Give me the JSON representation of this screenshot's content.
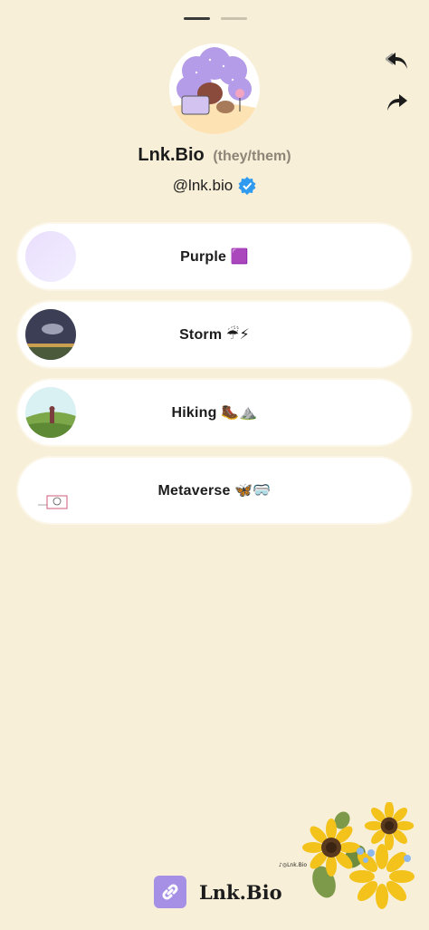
{
  "profile": {
    "name": "Lnk.Bio",
    "pronouns": "(they/them)",
    "handle": "@lnk.bio",
    "verified": true
  },
  "pager": {
    "count": 2,
    "active": 0
  },
  "actions": {
    "undo_icon": "reply-arrow-icon",
    "share_icon": "share-arrow-icon"
  },
  "links": [
    {
      "label": "Purple 🟪",
      "thumb": "purple-gradient"
    },
    {
      "label": "Storm ☔⚡",
      "thumb": "storm-photo"
    },
    {
      "label": "Hiking 🥾⛰️",
      "thumb": "hiking-illustration"
    },
    {
      "label": "Metaverse 🦋🥽",
      "thumb": "metaverse-sketch"
    }
  ],
  "watermark": {
    "text": "♪◎Lnk.Bio"
  },
  "footer": {
    "brand": "Lnk.Bio",
    "logo_icon": "link-chain-icon"
  },
  "colors": {
    "background": "#f7efd7",
    "card": "#ffffff",
    "accent": "#a690e6",
    "verified": "#2f9bf0"
  }
}
